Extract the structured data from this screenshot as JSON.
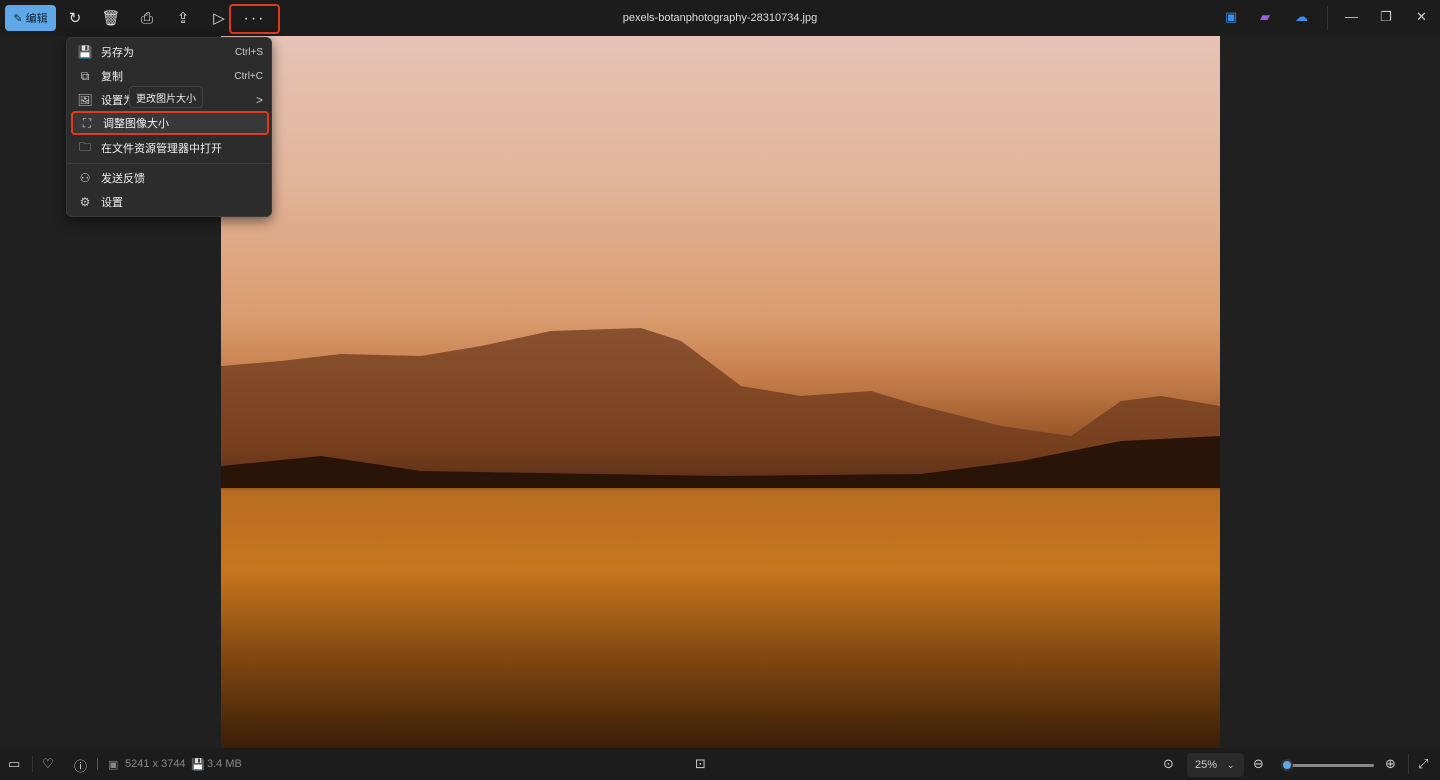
{
  "toolbar": {
    "edit_label": "编辑",
    "more_label": "···"
  },
  "title": "pexels-botanphotography-28310734.jpg",
  "menu": {
    "items": [
      {
        "label": "另存为",
        "shortcut": "Ctrl+S"
      },
      {
        "label": "复制",
        "shortcut": "Ctrl+C"
      },
      {
        "label": "设置为",
        "arrow": ">"
      },
      {
        "label": "调整图像大小"
      },
      {
        "label": "在文件资源管理器中打开"
      },
      {
        "label": "发送反馈"
      },
      {
        "label": "设置"
      }
    ],
    "tooltip": "更改图片大小"
  },
  "status": {
    "dimensions": "5241 x 3744",
    "size": "3.4 MB",
    "zoom": "25%",
    "zoom_slider_fraction": 0.02
  },
  "colors": {
    "accent": "#5fa8e8",
    "highlight": "#e0391f"
  }
}
